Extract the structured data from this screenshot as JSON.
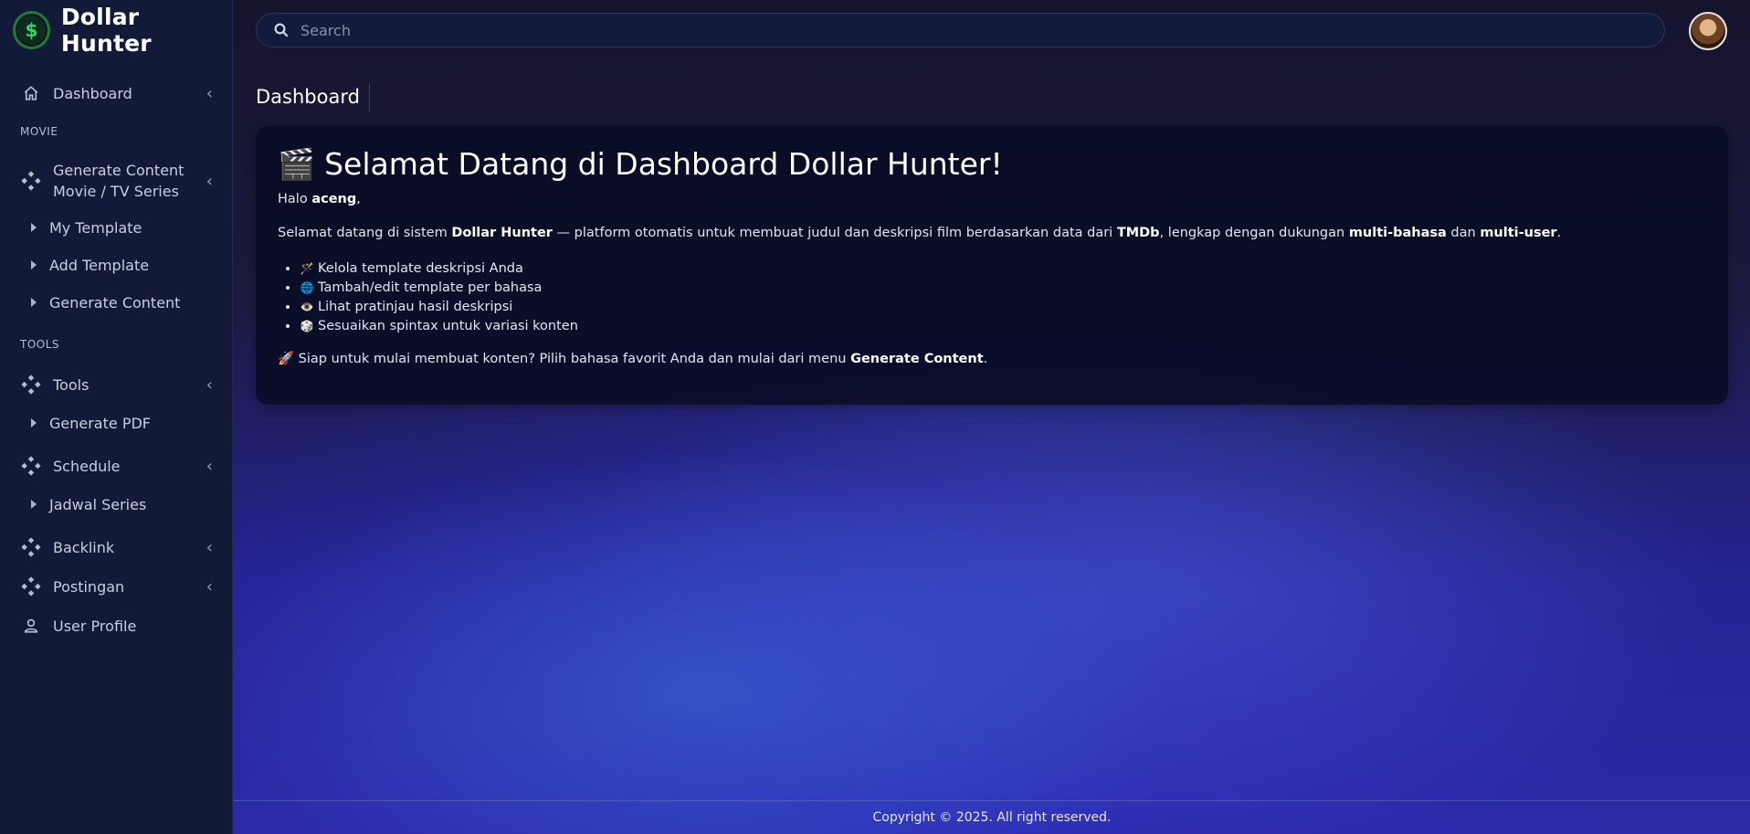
{
  "brand": {
    "name": "Dollar Hunter",
    "logo_icon": "dollar-coin-icon",
    "logo_symbol": "$"
  },
  "search": {
    "placeholder": "Search",
    "icon": "search-icon"
  },
  "page": {
    "title": "Dashboard"
  },
  "sidebar": {
    "dashboard": {
      "label": "Dashboard",
      "icon": "home-icon"
    },
    "section_movie": "MOVIE",
    "generate_content_movie": {
      "label_line1": "Generate Content",
      "label_line2": "Movie / TV Series",
      "icon": "diamond-nodes-icon"
    },
    "my_template": "My Template",
    "add_template": "Add Template",
    "generate_content": "Generate Content",
    "section_tools": "TOOLS",
    "tools": {
      "label": "Tools",
      "icon": "diamond-nodes-icon"
    },
    "generate_pdf": "Generate PDF",
    "schedule": {
      "label": "Schedule",
      "icon": "diamond-nodes-icon"
    },
    "jadwal_series": "Jadwal Series",
    "backlink": {
      "label": "Backlink",
      "icon": "diamond-nodes-icon"
    },
    "postingan": {
      "label": "Postingan",
      "icon": "diamond-nodes-icon"
    },
    "user_profile": {
      "label": "User Profile",
      "icon": "user-icon"
    }
  },
  "welcome": {
    "emoji": "🎬",
    "heading": "Selamat Datang di Dashboard Dollar Hunter!",
    "greeting_prefix": "Halo ",
    "username": "aceng",
    "greeting_suffix": ",",
    "intro_1": "Selamat datang di sistem ",
    "intro_brand": "Dollar Hunter",
    "intro_2": " — platform otomatis untuk membuat judul dan deskripsi film berdasarkan data dari ",
    "intro_tmdb": "TMDb",
    "intro_3": ", lengkap dengan dukungan ",
    "intro_multibahasa": "multi-bahasa",
    "intro_4": " dan ",
    "intro_multiuser": "multi-user",
    "intro_5": ".",
    "features": [
      {
        "emoji": "🪄",
        "text": "Kelola template deskripsi Anda"
      },
      {
        "emoji": "🌐",
        "text": "Tambah/edit template per bahasa"
      },
      {
        "emoji": "👁️",
        "text": "Lihat pratinjau hasil deskripsi"
      },
      {
        "emoji": "🎲",
        "text": "Sesuaikan spintax untuk variasi konten"
      }
    ],
    "cta_emoji": "🚀",
    "cta_text": " Siap untuk mulai membuat konten? Pilih bahasa favorit Anda dan mulai dari menu ",
    "cta_bold": "Generate Content",
    "cta_end": "."
  },
  "footer": {
    "text": "Copyright © 2025. All right reserved."
  },
  "colors": {
    "sidebar_bg": "#121a38",
    "card_bg": "#0a0d26",
    "logo_green": "#3ad36b"
  }
}
